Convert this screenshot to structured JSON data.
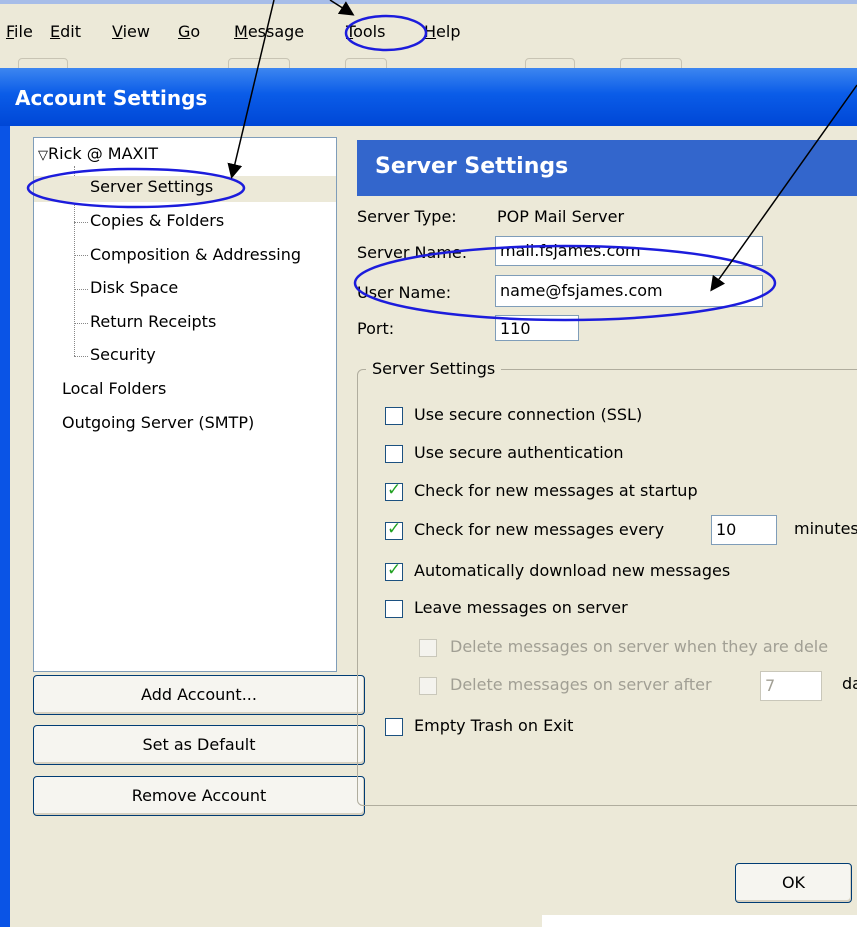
{
  "menubar": {
    "items": [
      {
        "label": "File",
        "underline": "F"
      },
      {
        "label": "Edit",
        "underline": "E"
      },
      {
        "label": "View",
        "underline": "V"
      },
      {
        "label": "Go",
        "underline": "G"
      },
      {
        "label": "Message",
        "underline": "M"
      },
      {
        "label": "Tools",
        "underline": "T"
      },
      {
        "label": "Help",
        "underline": "H"
      }
    ]
  },
  "dialog": {
    "title": "Account Settings",
    "colors": {
      "titlebar": "#0a5ce8",
      "panel_header": "#3366cc",
      "annotation": "#1c1cdc",
      "check": "#21a121"
    }
  },
  "tree": {
    "account": "Rick @ MAXIT",
    "expander": "▽",
    "children": [
      "Server Settings",
      "Copies & Folders",
      "Composition & Addressing",
      "Disk Space",
      "Return Receipts",
      "Security"
    ],
    "other_accounts": [
      "Local Folders",
      "Outgoing Server (SMTP)"
    ],
    "selected": "Server Settings"
  },
  "buttons": {
    "add_account": "Add Account...",
    "set_default": "Set as Default",
    "remove_account": "Remove Account",
    "ok": "OK"
  },
  "panel": {
    "title": "Server Settings",
    "server_type_label": "Server Type:",
    "server_type_value": "POP Mail Server",
    "server_name_label": "Server Name:",
    "server_name_value": "mail.fsjames.com",
    "user_name_label": "User Name:",
    "user_name_value": "name@fsjames.com",
    "port_label": "Port:",
    "port_value": "110",
    "group_title": "Server Settings",
    "options": {
      "ssl": {
        "label": "Use secure connection (SSL)",
        "checked": false
      },
      "secure_auth": {
        "label": "Use secure authentication",
        "checked": false
      },
      "check_startup": {
        "label": "Check for new messages at startup",
        "checked": true
      },
      "check_every": {
        "label": "Check for new messages every",
        "checked": true,
        "value": "10",
        "unit": "minutes"
      },
      "auto_download": {
        "label": "Automatically download new messages",
        "checked": true
      },
      "leave_on_server": {
        "label": "Leave messages on server",
        "checked": false
      },
      "delete_when_deleted": {
        "label": "Delete messages on server when they are dele",
        "checked": false,
        "disabled": true
      },
      "delete_after": {
        "label": "Delete messages on server after",
        "checked": false,
        "disabled": true,
        "value": "7",
        "unit": "da"
      },
      "empty_trash": {
        "label": "Empty Trash on Exit",
        "checked": false
      }
    }
  }
}
